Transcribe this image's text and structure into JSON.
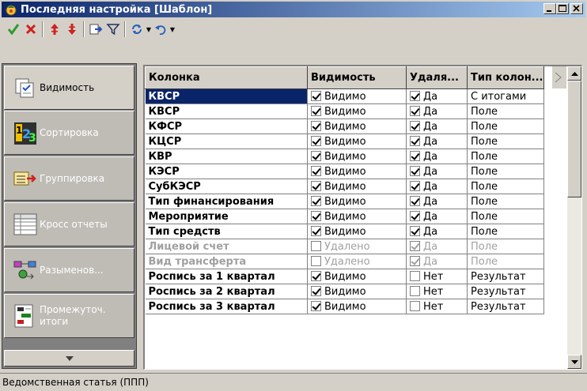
{
  "window": {
    "title": "Последняя настройка [Шаблон]",
    "buttons": [
      "minimize",
      "maximize",
      "close"
    ]
  },
  "toolbar": {
    "items": [
      {
        "name": "apply-icon",
        "color": "#2e9b2e"
      },
      {
        "name": "cancel-icon",
        "color": "#d02020"
      },
      {
        "name": "move-up-icon",
        "color": "#d02020"
      },
      {
        "name": "move-down-icon",
        "color": "#d02020"
      },
      {
        "name": "export-icon"
      },
      {
        "name": "filter-icon"
      },
      {
        "name": "refresh-icon"
      },
      {
        "name": "undo-icon"
      }
    ]
  },
  "sidebar": {
    "items": [
      {
        "label": "Видимость",
        "icon": "visibility-icon"
      },
      {
        "label": "Сортировка",
        "icon": "sort-icon"
      },
      {
        "label": "Группировка",
        "icon": "grouping-icon"
      },
      {
        "label": "Кросс отчеты",
        "icon": "cross-report-icon"
      },
      {
        "label": "Разыменов...",
        "icon": "dereference-icon"
      },
      {
        "label": "Промежуточ.\nитоги",
        "icon": "subtotals-icon"
      }
    ]
  },
  "grid": {
    "columns": [
      "Колонка",
      "Видимость",
      "Удаля...",
      "Тип колон..."
    ],
    "rows": [
      {
        "name": "КВСР",
        "visible": true,
        "visible_text": "Видимо",
        "del": true,
        "del_text": "Да",
        "type": "С итогами",
        "selected": true,
        "removed": false
      },
      {
        "name": "КВСР",
        "visible": true,
        "visible_text": "Видимо",
        "del": true,
        "del_text": "Да",
        "type": "Поле",
        "selected": false,
        "removed": false
      },
      {
        "name": "КФСР",
        "visible": true,
        "visible_text": "Видимо",
        "del": true,
        "del_text": "Да",
        "type": "Поле",
        "selected": false,
        "removed": false
      },
      {
        "name": "КЦСР",
        "visible": true,
        "visible_text": "Видимо",
        "del": true,
        "del_text": "Да",
        "type": "Поле",
        "selected": false,
        "removed": false
      },
      {
        "name": "КВР",
        "visible": true,
        "visible_text": "Видимо",
        "del": true,
        "del_text": "Да",
        "type": "Поле",
        "selected": false,
        "removed": false
      },
      {
        "name": "КЭСР",
        "visible": true,
        "visible_text": "Видимо",
        "del": true,
        "del_text": "Да",
        "type": "Поле",
        "selected": false,
        "removed": false
      },
      {
        "name": "СубКЭСР",
        "visible": true,
        "visible_text": "Видимо",
        "del": true,
        "del_text": "Да",
        "type": "Поле",
        "selected": false,
        "removed": false
      },
      {
        "name": "Тип финансирования",
        "visible": true,
        "visible_text": "Видимо",
        "del": true,
        "del_text": "Да",
        "type": "Поле",
        "selected": false,
        "removed": false
      },
      {
        "name": "Мероприятие",
        "visible": true,
        "visible_text": "Видимо",
        "del": true,
        "del_text": "Да",
        "type": "Поле",
        "selected": false,
        "removed": false
      },
      {
        "name": "Тип средств",
        "visible": true,
        "visible_text": "Видимо",
        "del": true,
        "del_text": "Да",
        "type": "Поле",
        "selected": false,
        "removed": false
      },
      {
        "name": "Лицевой счет",
        "visible": false,
        "visible_text": "Удалено",
        "del": true,
        "del_text": "Да",
        "type": "Поле",
        "selected": false,
        "removed": true
      },
      {
        "name": "Вид трансферта",
        "visible": false,
        "visible_text": "Удалено",
        "del": true,
        "del_text": "Да",
        "type": "Поле",
        "selected": false,
        "removed": true
      },
      {
        "name": "Роспись за 1 квартал",
        "visible": true,
        "visible_text": "Видимо",
        "del": false,
        "del_text": "Нет",
        "type": "Результат",
        "selected": false,
        "removed": false
      },
      {
        "name": "Роспись за 2 квартал",
        "visible": true,
        "visible_text": "Видимо",
        "del": false,
        "del_text": "Нет",
        "type": "Результат",
        "selected": false,
        "removed": false
      },
      {
        "name": "Роспись за 3 квартал",
        "visible": true,
        "visible_text": "Видимо",
        "del": false,
        "del_text": "Нет",
        "type": "Результат",
        "selected": false,
        "removed": false
      }
    ]
  },
  "statusbar": {
    "text": "Ведомственная статья (ППП)"
  }
}
